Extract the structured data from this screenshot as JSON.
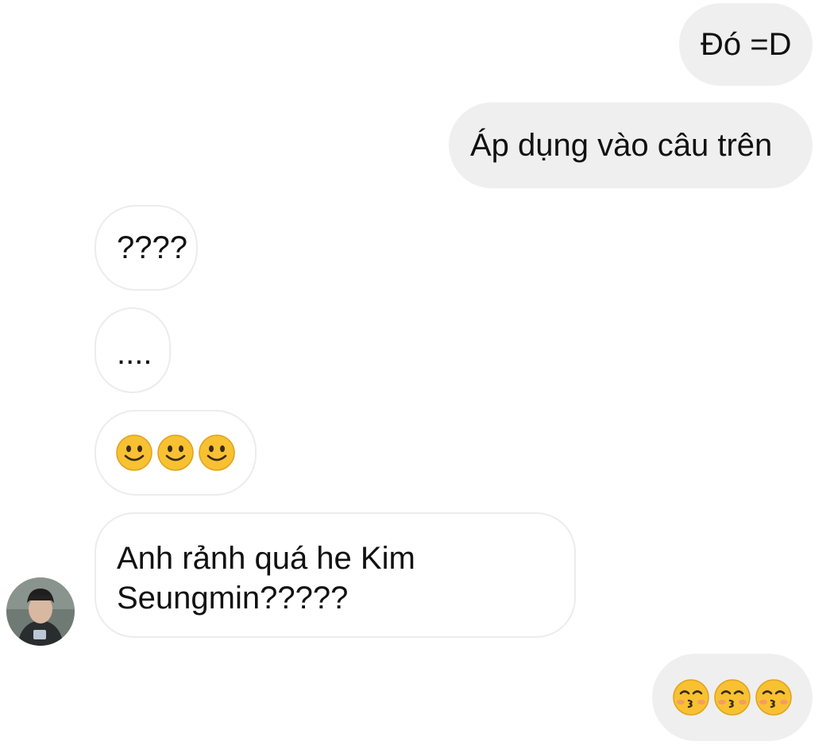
{
  "messages": {
    "m1": {
      "text": "Đó =D",
      "from": "me"
    },
    "m2": {
      "text": "Áp dụng vào câu trên",
      "from": "me"
    },
    "m3": {
      "text": "????",
      "from": "them"
    },
    "m4": {
      "text": "....",
      "from": "them"
    },
    "m5": {
      "emoji": [
        "slightly-smiling-face",
        "slightly-smiling-face",
        "slightly-smiling-face"
      ],
      "from": "them"
    },
    "m6": {
      "line1": "Anh rảnh quá he Kim",
      "line2": "Seungmin?????",
      "from": "them"
    },
    "m7": {
      "emoji": [
        "kissing-face-with-smiling-eyes",
        "kissing-face-with-smiling-eyes",
        "kissing-face-with-smiling-eyes"
      ],
      "from": "me"
    }
  },
  "colors": {
    "sent_bubble": "#efefef",
    "received_border": "#ececec",
    "emoji_yellow": "#f8c132"
  },
  "avatar": {
    "icon": "contact-avatar"
  }
}
